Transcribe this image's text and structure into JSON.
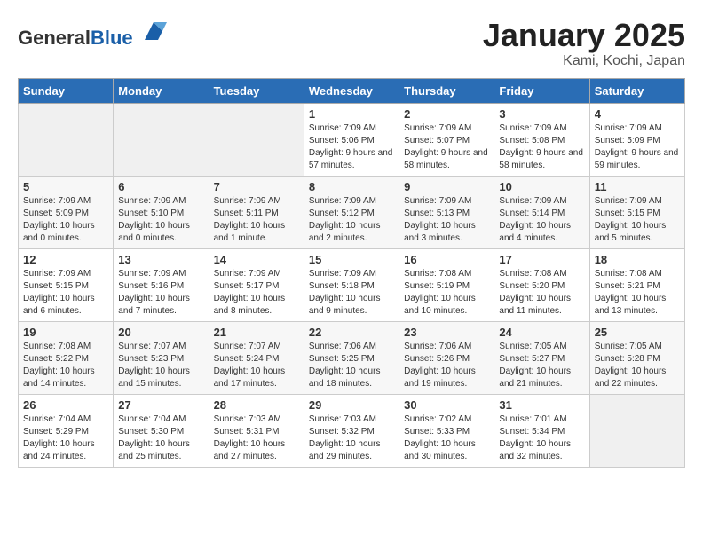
{
  "header": {
    "logo": {
      "general": "General",
      "blue": "Blue"
    },
    "title": "January 2025",
    "subtitle": "Kami, Kochi, Japan"
  },
  "weekdays": [
    "Sunday",
    "Monday",
    "Tuesday",
    "Wednesday",
    "Thursday",
    "Friday",
    "Saturday"
  ],
  "weeks": [
    [
      {
        "day": "",
        "empty": true
      },
      {
        "day": "",
        "empty": true
      },
      {
        "day": "",
        "empty": true
      },
      {
        "day": "1",
        "sunrise": "7:09 AM",
        "sunset": "5:06 PM",
        "daylight": "9 hours and 57 minutes."
      },
      {
        "day": "2",
        "sunrise": "7:09 AM",
        "sunset": "5:07 PM",
        "daylight": "9 hours and 58 minutes."
      },
      {
        "day": "3",
        "sunrise": "7:09 AM",
        "sunset": "5:08 PM",
        "daylight": "9 hours and 58 minutes."
      },
      {
        "day": "4",
        "sunrise": "7:09 AM",
        "sunset": "5:09 PM",
        "daylight": "9 hours and 59 minutes."
      }
    ],
    [
      {
        "day": "5",
        "sunrise": "7:09 AM",
        "sunset": "5:09 PM",
        "daylight": "10 hours and 0 minutes."
      },
      {
        "day": "6",
        "sunrise": "7:09 AM",
        "sunset": "5:10 PM",
        "daylight": "10 hours and 0 minutes."
      },
      {
        "day": "7",
        "sunrise": "7:09 AM",
        "sunset": "5:11 PM",
        "daylight": "10 hours and 1 minute."
      },
      {
        "day": "8",
        "sunrise": "7:09 AM",
        "sunset": "5:12 PM",
        "daylight": "10 hours and 2 minutes."
      },
      {
        "day": "9",
        "sunrise": "7:09 AM",
        "sunset": "5:13 PM",
        "daylight": "10 hours and 3 minutes."
      },
      {
        "day": "10",
        "sunrise": "7:09 AM",
        "sunset": "5:14 PM",
        "daylight": "10 hours and 4 minutes."
      },
      {
        "day": "11",
        "sunrise": "7:09 AM",
        "sunset": "5:15 PM",
        "daylight": "10 hours and 5 minutes."
      }
    ],
    [
      {
        "day": "12",
        "sunrise": "7:09 AM",
        "sunset": "5:15 PM",
        "daylight": "10 hours and 6 minutes."
      },
      {
        "day": "13",
        "sunrise": "7:09 AM",
        "sunset": "5:16 PM",
        "daylight": "10 hours and 7 minutes."
      },
      {
        "day": "14",
        "sunrise": "7:09 AM",
        "sunset": "5:17 PM",
        "daylight": "10 hours and 8 minutes."
      },
      {
        "day": "15",
        "sunrise": "7:09 AM",
        "sunset": "5:18 PM",
        "daylight": "10 hours and 9 minutes."
      },
      {
        "day": "16",
        "sunrise": "7:08 AM",
        "sunset": "5:19 PM",
        "daylight": "10 hours and 10 minutes."
      },
      {
        "day": "17",
        "sunrise": "7:08 AM",
        "sunset": "5:20 PM",
        "daylight": "10 hours and 11 minutes."
      },
      {
        "day": "18",
        "sunrise": "7:08 AM",
        "sunset": "5:21 PM",
        "daylight": "10 hours and 13 minutes."
      }
    ],
    [
      {
        "day": "19",
        "sunrise": "7:08 AM",
        "sunset": "5:22 PM",
        "daylight": "10 hours and 14 minutes."
      },
      {
        "day": "20",
        "sunrise": "7:07 AM",
        "sunset": "5:23 PM",
        "daylight": "10 hours and 15 minutes."
      },
      {
        "day": "21",
        "sunrise": "7:07 AM",
        "sunset": "5:24 PM",
        "daylight": "10 hours and 17 minutes."
      },
      {
        "day": "22",
        "sunrise": "7:06 AM",
        "sunset": "5:25 PM",
        "daylight": "10 hours and 18 minutes."
      },
      {
        "day": "23",
        "sunrise": "7:06 AM",
        "sunset": "5:26 PM",
        "daylight": "10 hours and 19 minutes."
      },
      {
        "day": "24",
        "sunrise": "7:05 AM",
        "sunset": "5:27 PM",
        "daylight": "10 hours and 21 minutes."
      },
      {
        "day": "25",
        "sunrise": "7:05 AM",
        "sunset": "5:28 PM",
        "daylight": "10 hours and 22 minutes."
      }
    ],
    [
      {
        "day": "26",
        "sunrise": "7:04 AM",
        "sunset": "5:29 PM",
        "daylight": "10 hours and 24 minutes."
      },
      {
        "day": "27",
        "sunrise": "7:04 AM",
        "sunset": "5:30 PM",
        "daylight": "10 hours and 25 minutes."
      },
      {
        "day": "28",
        "sunrise": "7:03 AM",
        "sunset": "5:31 PM",
        "daylight": "10 hours and 27 minutes."
      },
      {
        "day": "29",
        "sunrise": "7:03 AM",
        "sunset": "5:32 PM",
        "daylight": "10 hours and 29 minutes."
      },
      {
        "day": "30",
        "sunrise": "7:02 AM",
        "sunset": "5:33 PM",
        "daylight": "10 hours and 30 minutes."
      },
      {
        "day": "31",
        "sunrise": "7:01 AM",
        "sunset": "5:34 PM",
        "daylight": "10 hours and 32 minutes."
      },
      {
        "day": "",
        "empty": true
      }
    ]
  ]
}
